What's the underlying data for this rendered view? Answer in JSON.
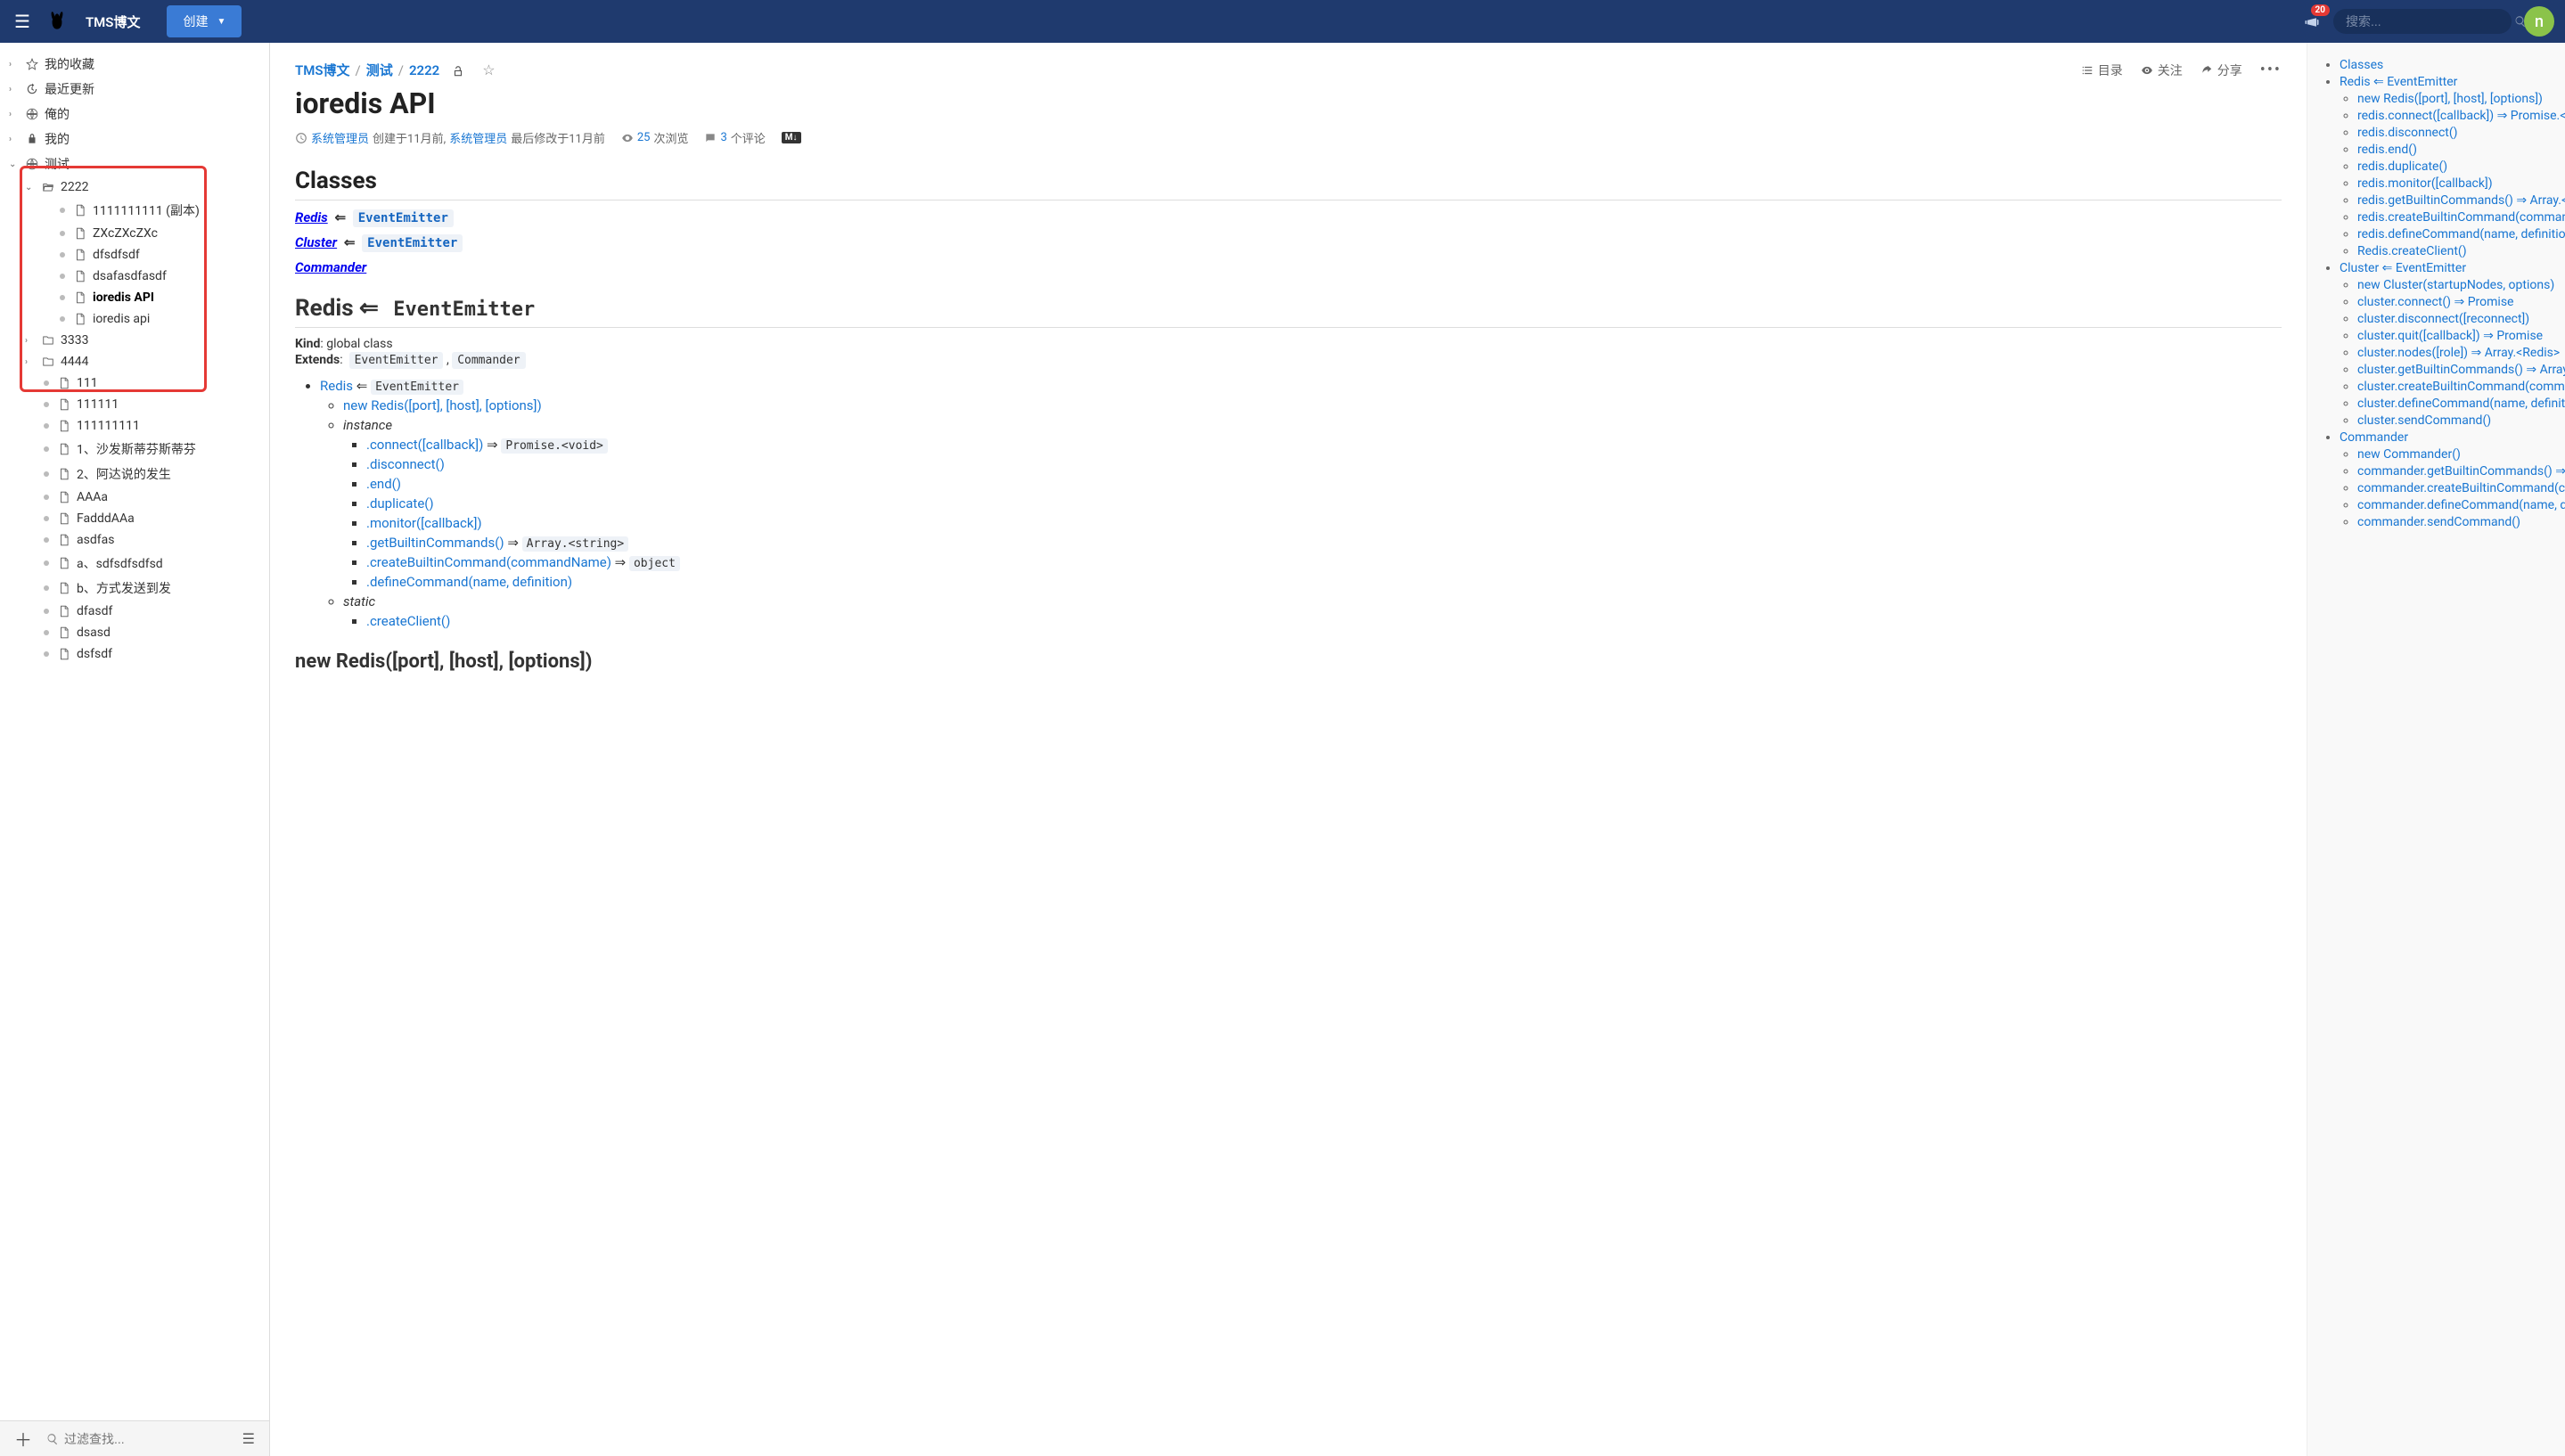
{
  "topbar": {
    "brand": "TMS博文",
    "create_label": "创建",
    "notif_count": "20",
    "search_placeholder": "搜索...",
    "avatar_letter": "n"
  },
  "sidebar": {
    "top_items": [
      {
        "icon": "star",
        "label": "我的收藏"
      },
      {
        "icon": "history",
        "label": "最近更新"
      },
      {
        "icon": "globe",
        "label": "俺的"
      },
      {
        "icon": "lock",
        "label": "我的"
      }
    ],
    "test_label": "测试",
    "folder_2222": "2222",
    "folder_2222_children": [
      "1111111111 (副本)",
      "ZXcZXcZXc",
      "dfsdfsdf",
      "dsafasdfasdf",
      "ioredis API",
      "ioredis api"
    ],
    "folder_3333": "3333",
    "folder_4444": "4444",
    "loose_files": [
      "111",
      "111111",
      "111111111",
      "1、沙发斯蒂芬斯蒂芬",
      "2、阿达说的发生",
      "AAAa",
      "FadddAAa",
      "asdfas",
      "a、sdfsdfsdfsd",
      "b、方式发送到发",
      "dfasdf",
      "dsasd",
      "dsfsdf"
    ],
    "filter_placeholder": "过滤查找..."
  },
  "breadcrumb": {
    "root": "TMS博文",
    "mid": "测试",
    "leaf": "2222"
  },
  "page_actions": {
    "toc": "目录",
    "follow": "关注",
    "share": "分享"
  },
  "page": {
    "title": "ioredis API",
    "author": "系统管理员",
    "created_text": "创建于11月前,",
    "modifier": "系统管理员",
    "modified_text": "最后修改于11月前",
    "views": "25",
    "views_suffix": "次浏览",
    "comments": "3",
    "comments_suffix": "个评论"
  },
  "content": {
    "classes_heading": "Classes",
    "redis": "Redis",
    "cluster": "Cluster",
    "commander": "Commander",
    "event_emitter": "EventEmitter",
    "kind_label": "Kind",
    "kind_value": ": global class",
    "extends_label": "Extends",
    "extends_sep": ":",
    "instance_label": "instance",
    "static_label": "static",
    "redis_methods": {
      "new": "new Redis([port], [host], [options])",
      "connect": ".connect([callback])",
      "connect_ret": "Promise.<void>",
      "disconnect": ".disconnect()",
      "end": ".end()",
      "duplicate": ".duplicate()",
      "monitor": ".monitor([callback])",
      "getbuiltin": ".getBuiltinCommands()",
      "getbuiltin_ret": "Array.<string>",
      "createbuiltin": ".createBuiltinCommand(commandName)",
      "createbuiltin_ret": "object",
      "definecmd": ".defineCommand(name, definition)",
      "createclient": ".createClient()"
    },
    "h2_newredis": "new Redis([port], [host], [options])"
  },
  "toc": {
    "items": [
      {
        "label": "Classes",
        "level": 0
      },
      {
        "label": "Redis ⇐ EventEmitter",
        "level": 0
      },
      {
        "label": "new Redis([port], [host], [options])",
        "level": 1
      },
      {
        "label": "redis.connect([callback]) ⇒ Promise.<vo",
        "level": 1
      },
      {
        "label": "redis.disconnect()",
        "level": 1
      },
      {
        "label": "redis.end()",
        "level": 1
      },
      {
        "label": "redis.duplicate()",
        "level": 1
      },
      {
        "label": "redis.monitor([callback])",
        "level": 1
      },
      {
        "label": "redis.getBuiltinCommands() ⇒ Array.<st",
        "level": 1
      },
      {
        "label": "redis.createBuiltinCommand(commandN",
        "level": 1
      },
      {
        "label": "redis.defineCommand(name, definition)",
        "level": 1
      },
      {
        "label": "Redis.createClient()",
        "level": 1
      },
      {
        "label": "Cluster ⇐ EventEmitter",
        "level": 0
      },
      {
        "label": "new Cluster(startupNodes, options)",
        "level": 1
      },
      {
        "label": "cluster.connect() ⇒ Promise",
        "level": 1
      },
      {
        "label": "cluster.disconnect([reconnect])",
        "level": 1
      },
      {
        "label": "cluster.quit([callback]) ⇒ Promise",
        "level": 1
      },
      {
        "label": "cluster.nodes([role]) ⇒ Array.<Redis>",
        "level": 1
      },
      {
        "label": "cluster.getBuiltinCommands() ⇒ Array.<",
        "level": 1
      },
      {
        "label": "cluster.createBuiltinCommand(command",
        "level": 1
      },
      {
        "label": "cluster.defineCommand(name, definition",
        "level": 1
      },
      {
        "label": "cluster.sendCommand()",
        "level": 1
      },
      {
        "label": "Commander",
        "level": 0
      },
      {
        "label": "new Commander()",
        "level": 1
      },
      {
        "label": "commander.getBuiltinCommands() ⇒ Ar",
        "level": 1
      },
      {
        "label": "commander.createBuiltinCommand(com",
        "level": 1
      },
      {
        "label": "commander.defineCommand(name, def",
        "level": 1
      },
      {
        "label": "commander.sendCommand()",
        "level": 1
      }
    ]
  }
}
